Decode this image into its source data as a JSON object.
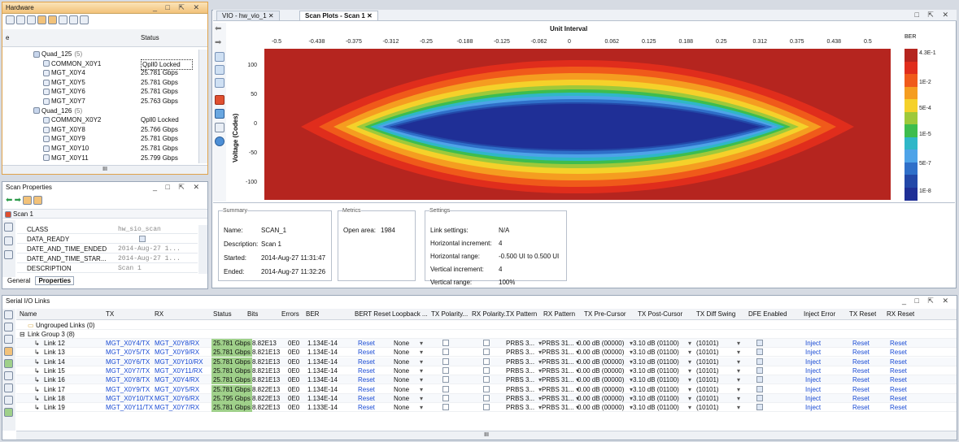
{
  "hardware": {
    "title": "Hardware",
    "col_name": "e",
    "col_status": "Status",
    "rows": [
      {
        "name": "Quad_125",
        "count": "(5)",
        "status": "",
        "kind": "quad"
      },
      {
        "name": "COMMON_X0Y1",
        "status": "Qpll0 Locked",
        "kind": "common",
        "selected": true
      },
      {
        "name": "MGT_X0Y4",
        "status": "25.781 Gbps",
        "kind": "mgt"
      },
      {
        "name": "MGT_X0Y5",
        "status": "25.781 Gbps",
        "kind": "mgt"
      },
      {
        "name": "MGT_X0Y6",
        "status": "25.781 Gbps",
        "kind": "mgt"
      },
      {
        "name": "MGT_X0Y7",
        "status": "25.763 Gbps",
        "kind": "mgt"
      },
      {
        "name": "Quad_126",
        "count": "(5)",
        "status": "",
        "kind": "quad"
      },
      {
        "name": "COMMON_X0Y2",
        "status": "Qpll0 Locked",
        "kind": "common"
      },
      {
        "name": "MGT_X0Y8",
        "status": "25.766 Gbps",
        "kind": "mgt"
      },
      {
        "name": "MGT_X0Y9",
        "status": "25.781 Gbps",
        "kind": "mgt"
      },
      {
        "name": "MGT_X0Y10",
        "status": "25.781 Gbps",
        "kind": "mgt"
      },
      {
        "name": "MGT_X0Y11",
        "status": "25.799 Gbps",
        "kind": "mgt"
      }
    ],
    "scroll_text": "III"
  },
  "scan_props": {
    "title": "Scan Properties",
    "scan_name": "Scan 1",
    "rows": [
      {
        "key": "CLASS",
        "value": "hw_sio_scan"
      },
      {
        "key": "DATA_READY",
        "value": ""
      },
      {
        "key": "DATE_AND_TIME_ENDED",
        "value": "2014-Aug-27 1..."
      },
      {
        "key": "DATE_AND_TIME_STAR...",
        "value": "2014-Aug-27 1..."
      },
      {
        "key": "DESCRIPTION",
        "value": "Scan 1"
      }
    ],
    "tabs": [
      "General",
      "Properties"
    ]
  },
  "tabs": [
    {
      "label": "VIO - hw_vio_1",
      "active": false
    },
    {
      "label": "Scan Plots - Scan 1",
      "active": true
    }
  ],
  "chart_data": {
    "type": "heatmap",
    "title": "Unit Interval",
    "xlabel": "Unit Interval",
    "ylabel": "Voltage (Codes)",
    "x_ticks": [
      "-0.5",
      "-0.438",
      "-0.375",
      "-0.312",
      "-0.25",
      "-0.188",
      "-0.125",
      "-0.062",
      "0",
      "0.062",
      "0.125",
      "0.188",
      "0.25",
      "0.312",
      "0.375",
      "0.438",
      "0.5"
    ],
    "xlim": [
      -0.5,
      0.5
    ],
    "ylim": [
      -127,
      127
    ],
    "y_ticks": [
      "100",
      "50",
      "0",
      "-50",
      "-100"
    ],
    "colorbar_title": "BER",
    "colorbar_labels": [
      "4.3E-1",
      "1E-2",
      "5E-4",
      "1E-5",
      "5E-7",
      "1E-8"
    ],
    "colorbar_colors": [
      "#b5251f",
      "#e02d1c",
      "#f05a1a",
      "#f59d20",
      "#f5d12a",
      "#9ec93a",
      "#3dbd4e",
      "#2fb7c8",
      "#4ea3e8",
      "#2f6fc9",
      "#2348a8",
      "#1f2f96"
    ],
    "open_area": 1984
  },
  "summary": {
    "title": "Summary",
    "name_label": "Name:",
    "name": "SCAN_1",
    "desc_label": "Description:",
    "desc": "Scan 1",
    "started_label": "Started:",
    "started": "2014-Aug-27 11:31:47",
    "ended_label": "Ended:",
    "ended": "2014-Aug-27 11:32:26"
  },
  "metrics": {
    "title": "Metrics",
    "open_area_label": "Open area:",
    "open_area": "1984"
  },
  "settings": {
    "title": "Settings",
    "link_label": "Link settings:",
    "link": "N/A",
    "hinc_label": "Horizontal increment:",
    "hinc": "4",
    "hrange_label": "Horizontal range:",
    "hrange": "-0.500 UI to 0.500 UI",
    "vinc_label": "Vertical increment:",
    "vinc": "4",
    "vrange_label": "Vertical range:",
    "vrange": "100%"
  },
  "serial": {
    "title": "Serial I/O Links",
    "columns": [
      "Name",
      "TX",
      "RX",
      "Status",
      "Bits",
      "Errors",
      "BER",
      "BERT Reset",
      "Loopback ...",
      "TX Polarity...",
      "RX Polarity...",
      "TX Pattern",
      "RX Pattern",
      "TX Pre-Cursor",
      "TX Post-Cursor",
      "TX Diff Swing",
      "DFE Enabled",
      "Inject Error",
      "TX Reset",
      "RX Reset"
    ],
    "ungrouped": "Ungrouped Links (0)",
    "group": "Link Group 3 (8)",
    "links": [
      {
        "name": "Link 12",
        "tx": "MGT_X0Y4/TX",
        "rx": "MGT_X0Y8/RX",
        "status": "25.781 Gbps",
        "bits": "8.82E13",
        "errors": "0E0",
        "ber": "1.134E-14"
      },
      {
        "name": "Link 13",
        "tx": "MGT_X0Y5/TX",
        "rx": "MGT_X0Y9/RX",
        "status": "25.781 Gbps",
        "bits": "8.821E13",
        "errors": "0E0",
        "ber": "1.134E-14"
      },
      {
        "name": "Link 14",
        "tx": "MGT_X0Y6/TX",
        "rx": "MGT_X0Y10/RX",
        "status": "25.781 Gbps",
        "bits": "8.821E13",
        "errors": "0E0",
        "ber": "1.134E-14"
      },
      {
        "name": "Link 15",
        "tx": "MGT_X0Y7/TX",
        "rx": "MGT_X0Y11/RX",
        "status": "25.781 Gbps",
        "bits": "8.821E13",
        "errors": "0E0",
        "ber": "1.134E-14"
      },
      {
        "name": "Link 16",
        "tx": "MGT_X0Y8/TX",
        "rx": "MGT_X0Y4/RX",
        "status": "25.781 Gbps",
        "bits": "8.821E13",
        "errors": "0E0",
        "ber": "1.134E-14"
      },
      {
        "name": "Link 17",
        "tx": "MGT_X0Y9/TX",
        "rx": "MGT_X0Y5/RX",
        "status": "25.781 Gbps",
        "bits": "8.822E13",
        "errors": "0E0",
        "ber": "1.134E-14"
      },
      {
        "name": "Link 18",
        "tx": "MGT_X0Y10/TX",
        "rx": "MGT_X0Y6/RX",
        "status": "25.795 Gbps",
        "bits": "8.822E13",
        "errors": "0E0",
        "ber": "1.134E-14"
      },
      {
        "name": "Link 19",
        "tx": "MGT_X0Y11/TX",
        "rx": "MGT_X0Y7/RX",
        "status": "25.781 Gbps",
        "bits": "8.822E13",
        "errors": "0E0",
        "ber": "1.133E-14"
      }
    ],
    "reset": "Reset",
    "loopback": "None",
    "tx_pattern": "PRBS 3...",
    "rx_pattern": "PRBS 31...",
    "pre": "0.00 dB (00000)",
    "post": "3.10 dB (01100)",
    "swing": "(10101)",
    "inject": "Inject",
    "scroll_text": "III"
  }
}
